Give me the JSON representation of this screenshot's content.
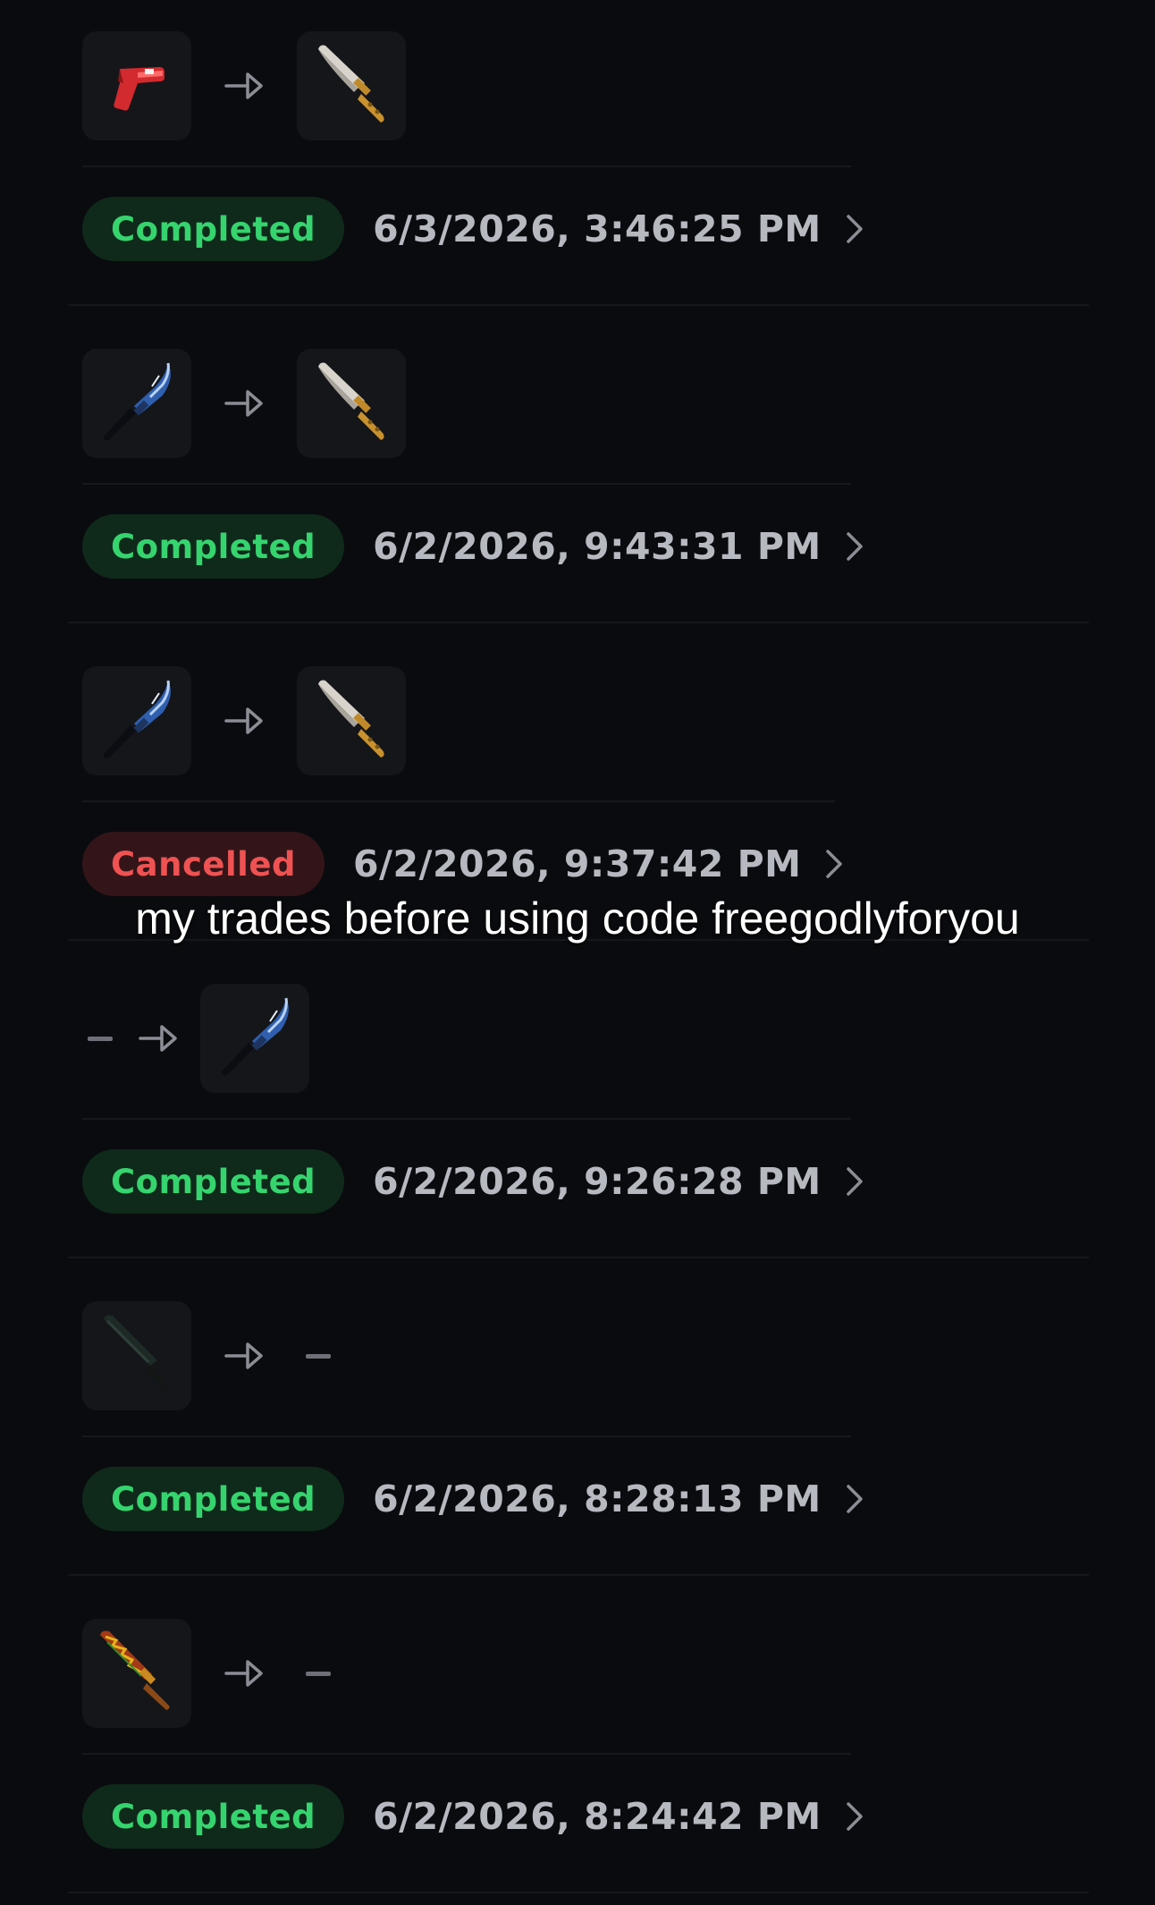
{
  "trades": [
    {
      "status": "Completed",
      "status_type": "completed",
      "timestamp": "6/3/2026, 3:46:25 PM",
      "give": "red-gun-icon",
      "receive": "gold-bowie-knife-icon"
    },
    {
      "status": "Completed",
      "status_type": "completed",
      "timestamp": "6/2/2026, 9:43:31 PM",
      "give": "blue-knife-icon",
      "receive": "gold-bowie-knife-icon"
    },
    {
      "status": "Cancelled",
      "status_type": "cancelled",
      "timestamp": "6/2/2026, 9:37:42 PM",
      "give": "blue-knife-icon",
      "receive": "gold-bowie-knife-icon"
    },
    {
      "status": "Completed",
      "status_type": "completed",
      "timestamp": "6/2/2026, 9:26:28 PM",
      "give": null,
      "receive": "blue-knife-icon"
    },
    {
      "status": "Completed",
      "status_type": "completed",
      "timestamp": "6/2/2026, 8:28:13 PM",
      "give": "dark-knife-icon",
      "receive": null
    },
    {
      "status": "Completed",
      "status_type": "completed",
      "timestamp": "6/2/2026, 8:24:42 PM",
      "give": "flame-knife-icon",
      "receive": null
    }
  ],
  "overlay_caption": "my trades before using code freegodlyforyou",
  "colors": {
    "background": "#0a0b0e",
    "completed_text": "#35d46e",
    "completed_bg": "#0f2a1b",
    "cancelled_text": "#ef5252",
    "cancelled_bg": "#331519"
  }
}
